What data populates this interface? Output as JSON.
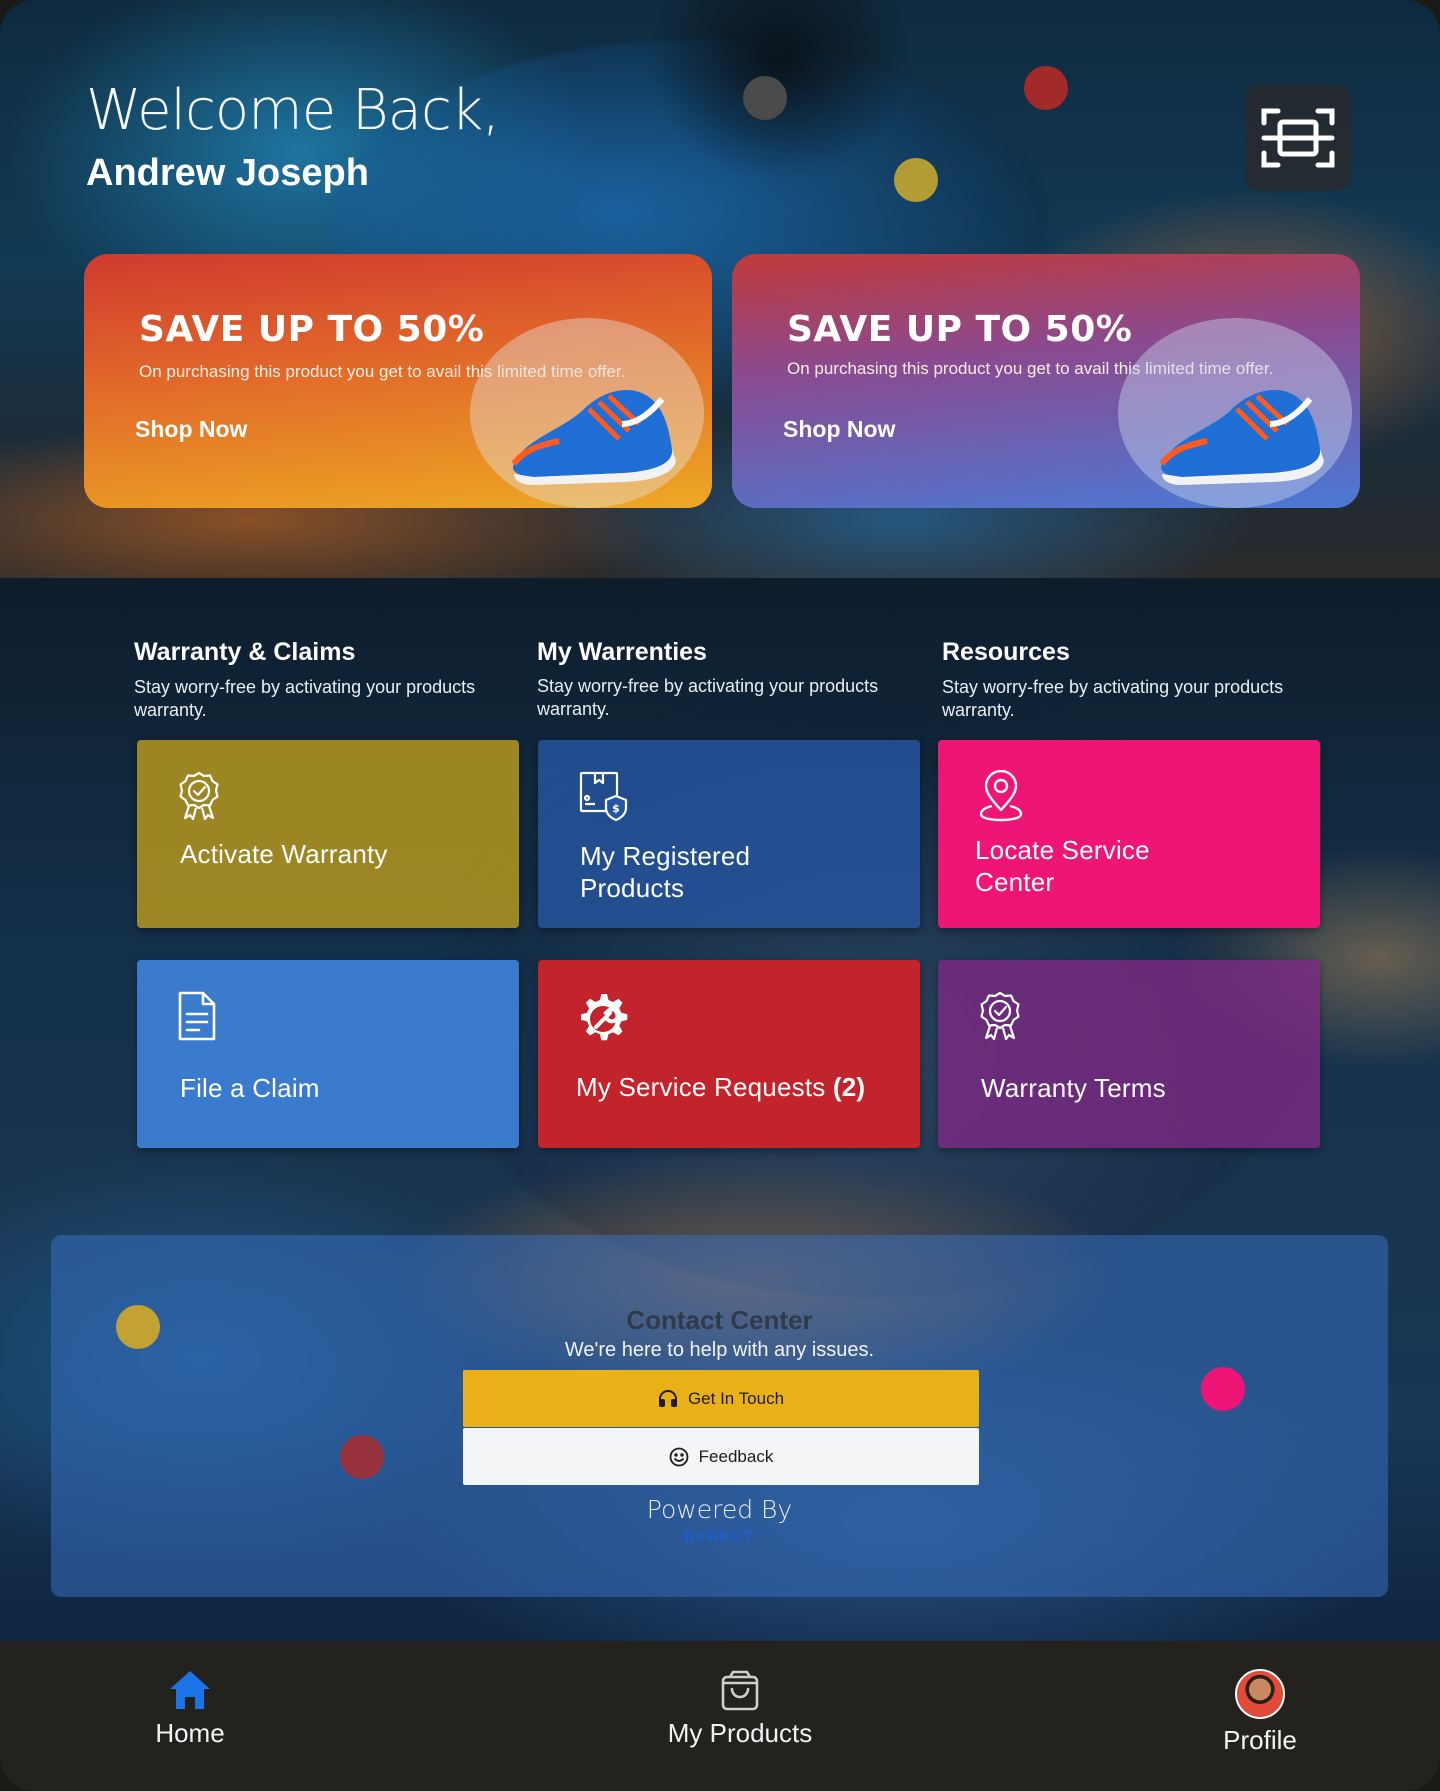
{
  "header": {
    "welcome": "Welcome Back,",
    "user_name": "Andrew Joseph",
    "scan_icon": "scan-icon"
  },
  "promos": [
    {
      "title": "SAVE UP TO 50%",
      "description": "On purchasing this product you get to avail this limited time offer.",
      "cta": "Shop Now"
    },
    {
      "title": "SAVE UP TO 50%",
      "description": "On purchasing this product you get to avail this limited time offer.",
      "cta": "Shop Now"
    }
  ],
  "sections": [
    {
      "heading": "Warranty & Claims",
      "subtitle": "Stay worry-free by activating your products warranty."
    },
    {
      "heading": "My Warrenties",
      "subtitle": "Stay worry-free by activating your products warranty."
    },
    {
      "heading": "Resources",
      "subtitle": "Stay worry-free by activating your products warranty."
    }
  ],
  "tiles": {
    "activate_warranty": {
      "label": "Activate Warranty",
      "icon": "award-badge-icon",
      "color": "#c4a01c"
    },
    "registered_products": {
      "label_line1": "My Registered",
      "label_line2": "Products",
      "icon": "product-box-icon",
      "color": "#2656a0"
    },
    "locate_service": {
      "label_line1": "Locate Service",
      "label_line2": "Center",
      "icon": "map-pin-icon",
      "color": "#ee1576"
    },
    "file_claim": {
      "label": "File a Claim",
      "icon": "document-icon",
      "color": "#3a7bcd"
    },
    "service_requests": {
      "label": "My Service Requests",
      "count": "(2)",
      "icon": "gear-wrench-icon",
      "color": "#c3232a"
    },
    "warranty_terms": {
      "label": "Warranty Terms",
      "icon": "award-badge-icon",
      "color": "#7a2a82"
    }
  },
  "contact": {
    "title": "Contact Center",
    "subtitle": "We're here to help with any issues.",
    "get_in_touch": "Get In Touch",
    "feedback": "Feedback",
    "powered_by": "Powered By",
    "brand": "DYRECT"
  },
  "bottom_nav": {
    "home": "Home",
    "my_products": "My Products",
    "profile": "Profile"
  },
  "colors": {
    "accent_yellow": "#e9b017",
    "accent_pink": "#ee1576",
    "home_active": "#1a73e8"
  }
}
